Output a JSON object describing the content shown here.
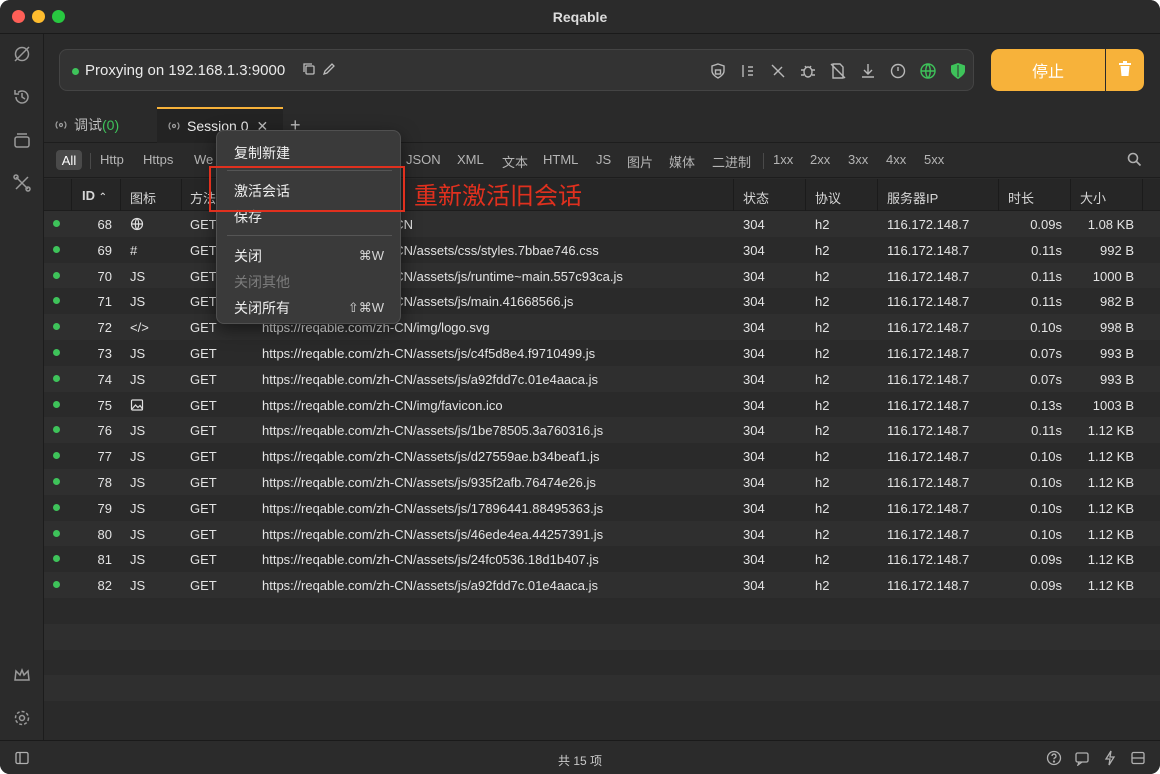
{
  "app": {
    "title": "Reqable"
  },
  "proxy": {
    "status_text": "Proxying on 192.168.1.3:9000"
  },
  "toolbar": {
    "icons": [
      "lock-icon",
      "rewrite-icon",
      "breakpoint-off-icon",
      "bug-icon",
      "file-blocked-icon",
      "download-icon",
      "gauge-icon",
      "globe-icon",
      "shield-check-icon"
    ],
    "stop_label": "停止",
    "accent_color": "#f7b23a"
  },
  "tabs": [
    {
      "label": "调试",
      "count": "(0)"
    },
    {
      "label": "Session 0"
    }
  ],
  "filters": {
    "all": "All",
    "items": [
      "Http",
      "Https",
      "We",
      "JSON",
      "XML",
      "文本",
      "HTML",
      "JS",
      "图片",
      "媒体",
      "二进制",
      "1xx",
      "2xx",
      "3xx",
      "4xx",
      "5xx"
    ]
  },
  "columns": {
    "id": "ID",
    "icon": "图标",
    "method": "方法",
    "status": "状态",
    "protocol": "协议",
    "server_ip": "服务器IP",
    "duration": "时长",
    "size": "大小"
  },
  "rows": [
    {
      "id": "68",
      "icon": "globe",
      "method": "GET",
      "url": "https://reqable.com/zh-CN",
      "status": "304",
      "protocol": "h2",
      "ip": "116.172.148.7",
      "time": "0.09s",
      "size": "1.08 KB"
    },
    {
      "id": "69",
      "icon": "#",
      "method": "GET",
      "url": "https://reqable.com/zh-CN/assets/css/styles.7bbae746.css",
      "status": "304",
      "protocol": "h2",
      "ip": "116.172.148.7",
      "time": "0.11s",
      "size": "992 B"
    },
    {
      "id": "70",
      "icon": "JS",
      "method": "GET",
      "url": "https://reqable.com/zh-CN/assets/js/runtime~main.557c93ca.js",
      "status": "304",
      "protocol": "h2",
      "ip": "116.172.148.7",
      "time": "0.11s",
      "size": "1000 B"
    },
    {
      "id": "71",
      "icon": "JS",
      "method": "GET",
      "url": "https://reqable.com/zh-CN/assets/js/main.41668566.js",
      "status": "304",
      "protocol": "h2",
      "ip": "116.172.148.7",
      "time": "0.11s",
      "size": "982 B"
    },
    {
      "id": "72",
      "icon": "</>",
      "method": "GET",
      "url": "https://reqable.com/zh-CN/img/logo.svg",
      "status": "304",
      "protocol": "h2",
      "ip": "116.172.148.7",
      "time": "0.10s",
      "size": "998 B"
    },
    {
      "id": "73",
      "icon": "JS",
      "method": "GET",
      "url": "https://reqable.com/zh-CN/assets/js/c4f5d8e4.f9710499.js",
      "status": "304",
      "protocol": "h2",
      "ip": "116.172.148.7",
      "time": "0.07s",
      "size": "993 B"
    },
    {
      "id": "74",
      "icon": "JS",
      "method": "GET",
      "url": "https://reqable.com/zh-CN/assets/js/a92fdd7c.01e4aaca.js",
      "status": "304",
      "protocol": "h2",
      "ip": "116.172.148.7",
      "time": "0.07s",
      "size": "993 B"
    },
    {
      "id": "75",
      "icon": "image",
      "method": "GET",
      "url": "https://reqable.com/zh-CN/img/favicon.ico",
      "status": "304",
      "protocol": "h2",
      "ip": "116.172.148.7",
      "time": "0.13s",
      "size": "1003 B"
    },
    {
      "id": "76",
      "icon": "JS",
      "method": "GET",
      "url": "https://reqable.com/zh-CN/assets/js/1be78505.3a760316.js",
      "status": "304",
      "protocol": "h2",
      "ip": "116.172.148.7",
      "time": "0.11s",
      "size": "1.12 KB"
    },
    {
      "id": "77",
      "icon": "JS",
      "method": "GET",
      "url": "https://reqable.com/zh-CN/assets/js/d27559ae.b34beaf1.js",
      "status": "304",
      "protocol": "h2",
      "ip": "116.172.148.7",
      "time": "0.10s",
      "size": "1.12 KB"
    },
    {
      "id": "78",
      "icon": "JS",
      "method": "GET",
      "url": "https://reqable.com/zh-CN/assets/js/935f2afb.76474e26.js",
      "status": "304",
      "protocol": "h2",
      "ip": "116.172.148.7",
      "time": "0.10s",
      "size": "1.12 KB"
    },
    {
      "id": "79",
      "icon": "JS",
      "method": "GET",
      "url": "https://reqable.com/zh-CN/assets/js/17896441.88495363.js",
      "status": "304",
      "protocol": "h2",
      "ip": "116.172.148.7",
      "time": "0.10s",
      "size": "1.12 KB"
    },
    {
      "id": "80",
      "icon": "JS",
      "method": "GET",
      "url": "https://reqable.com/zh-CN/assets/js/46ede4ea.44257391.js",
      "status": "304",
      "protocol": "h2",
      "ip": "116.172.148.7",
      "time": "0.10s",
      "size": "1.12 KB"
    },
    {
      "id": "81",
      "icon": "JS",
      "method": "GET",
      "url": "https://reqable.com/zh-CN/assets/js/24fc0536.18d1b407.js",
      "status": "304",
      "protocol": "h2",
      "ip": "116.172.148.7",
      "time": "0.09s",
      "size": "1.12 KB"
    },
    {
      "id": "82",
      "icon": "JS",
      "method": "GET",
      "url": "https://reqable.com/zh-CN/assets/js/a92fdd7c.01e4aaca.js",
      "status": "304",
      "protocol": "h2",
      "ip": "116.172.148.7",
      "time": "0.09s",
      "size": "1.12 KB"
    }
  ],
  "context_menu": {
    "duplicate": "复制新建",
    "reactivate": "激活会话",
    "save": "保存",
    "close": "关闭",
    "close_shortcut": "⌘W",
    "close_others": "关闭其他",
    "close_all": "关闭所有",
    "close_all_shortcut": "⇧⌘W"
  },
  "annotation": {
    "text": "重新激活旧会话",
    "color": "#e0301e"
  },
  "statusbar": {
    "text": "共 15 项"
  }
}
